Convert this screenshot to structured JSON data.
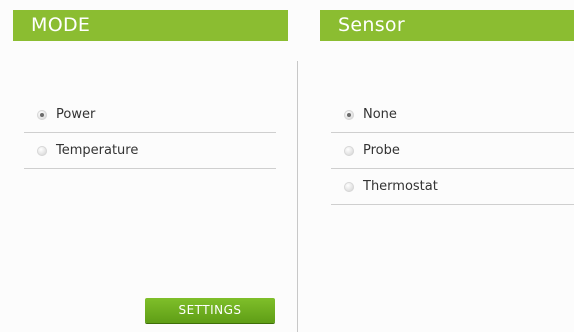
{
  "mode": {
    "title": "MODE",
    "options": [
      {
        "label": "Power",
        "checked": true
      },
      {
        "label": "Temperature",
        "checked": false
      }
    ],
    "settings_label": "SETTINGS"
  },
  "sensor": {
    "title": "Sensor",
    "options": [
      {
        "label": "None",
        "checked": true
      },
      {
        "label": "Probe",
        "checked": false
      },
      {
        "label": "Thermostat",
        "checked": false
      }
    ]
  },
  "colors": {
    "accent": "#8bbd31",
    "button": "#6aa91f"
  }
}
